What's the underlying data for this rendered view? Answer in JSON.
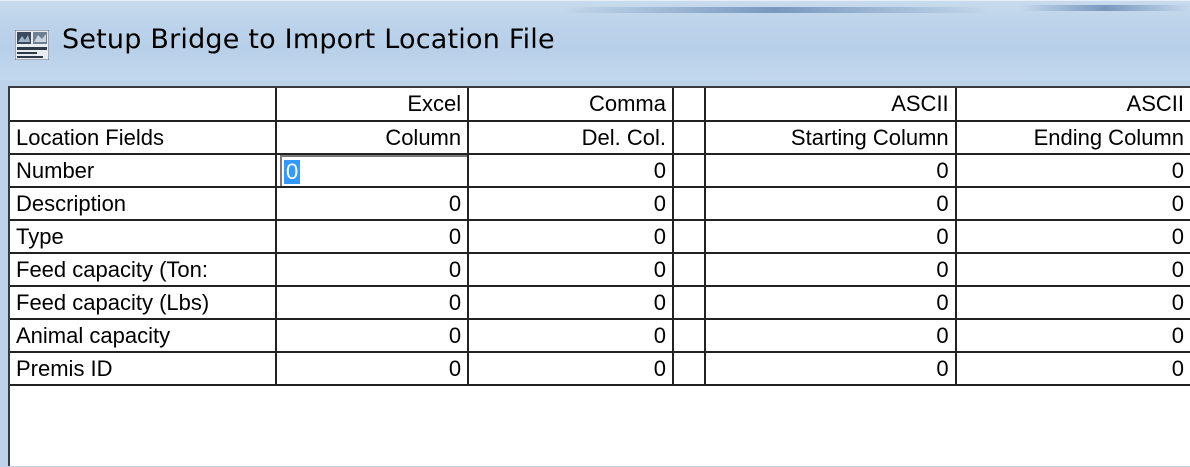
{
  "window": {
    "title": "Setup Bridge to Import Location File",
    "icon": "application-icon"
  },
  "grid": {
    "header_row1": [
      "",
      "Excel",
      "Comma",
      "",
      "ASCII",
      "ASCII"
    ],
    "header_row2": [
      "Location Fields",
      "Column",
      "Del. Col.",
      "",
      "Starting Column",
      "Ending Column"
    ],
    "rows": [
      {
        "label": "Number",
        "excel": "0",
        "comma": "0",
        "ascii_start": "0",
        "ascii_end": "0"
      },
      {
        "label": "Description",
        "excel": "0",
        "comma": "0",
        "ascii_start": "0",
        "ascii_end": "0"
      },
      {
        "label": "Type",
        "excel": "0",
        "comma": "0",
        "ascii_start": "0",
        "ascii_end": "0"
      },
      {
        "label": "Feed capacity (Ton:",
        "excel": "0",
        "comma": "0",
        "ascii_start": "0",
        "ascii_end": "0"
      },
      {
        "label": "Feed capacity (Lbs)",
        "excel": "0",
        "comma": "0",
        "ascii_start": "0",
        "ascii_end": "0"
      },
      {
        "label": "Animal capacity",
        "excel": "0",
        "comma": "0",
        "ascii_start": "0",
        "ascii_end": "0"
      },
      {
        "label": "Premis ID",
        "excel": "0",
        "comma": "0",
        "ascii_start": "0",
        "ascii_end": "0"
      }
    ],
    "active_cell": {
      "row": "Number",
      "column": "Excel Column",
      "value": "0",
      "selected": true
    }
  },
  "colors": {
    "titlebar": "#bcd3ea",
    "selection": "#3399ff",
    "grid_lines": "#222222"
  }
}
